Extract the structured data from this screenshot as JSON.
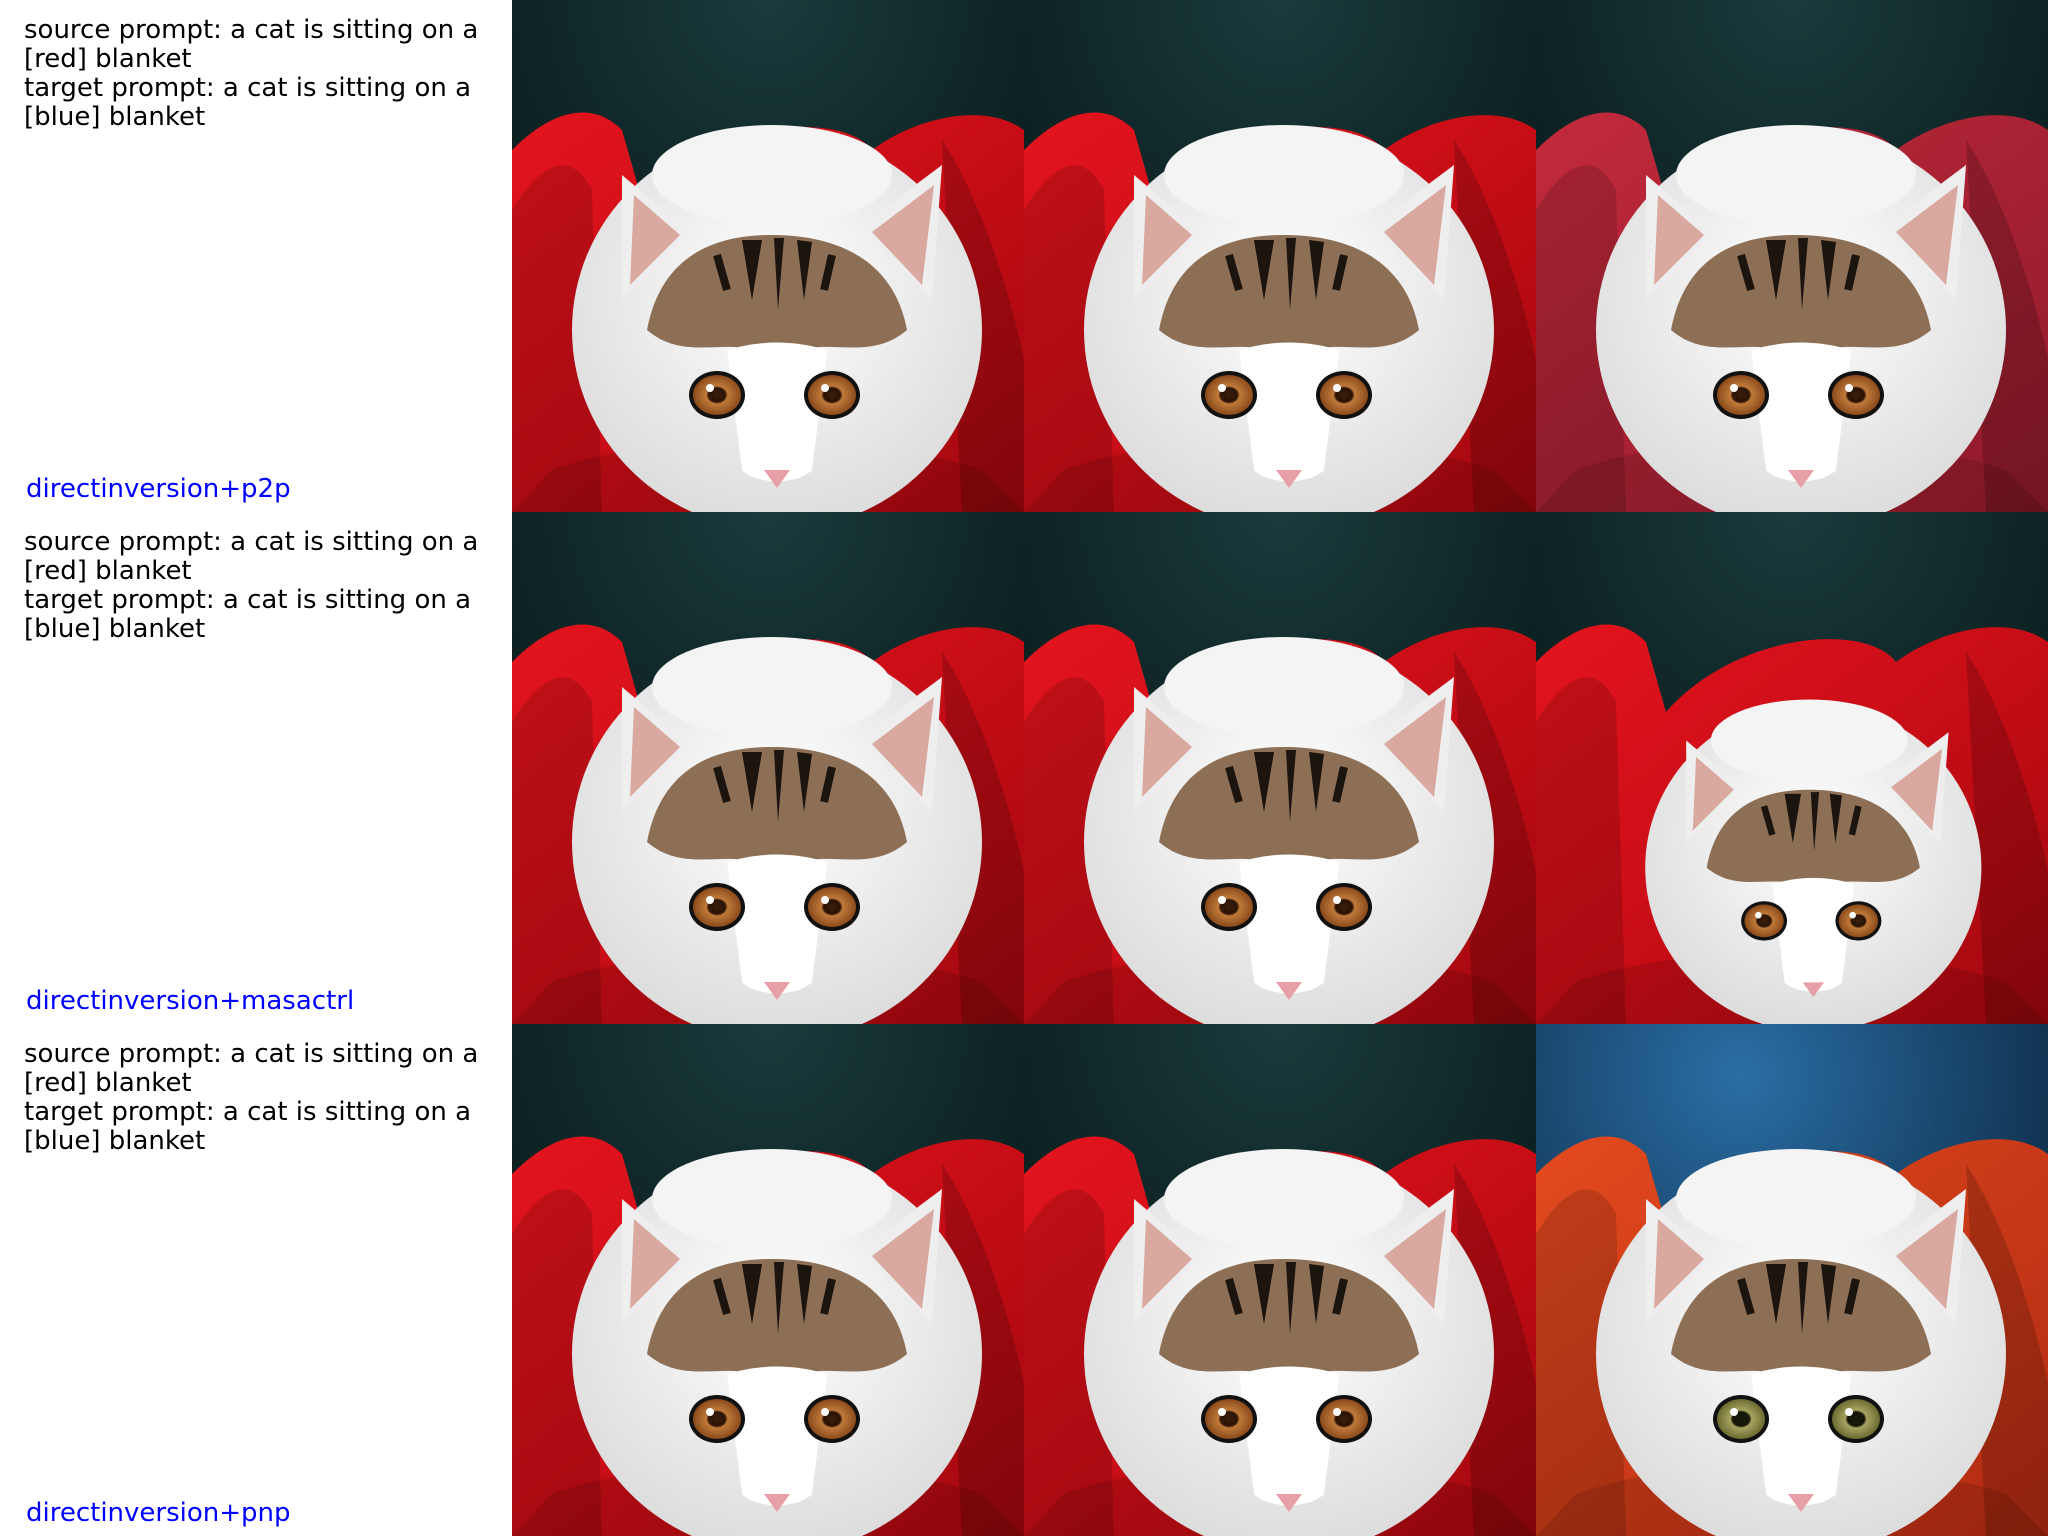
{
  "rows": [
    {
      "source_prompt": "source prompt: a cat is sitting on a [red] blanket",
      "target_prompt": "target prompt: a cat is sitting on a [blue] blanket",
      "method": "directinversion+p2p",
      "images": [
        "source-cat-red-blanket",
        "reconstruction-cat-red-blanket",
        "edited-cat-muted-red-blanket"
      ]
    },
    {
      "source_prompt": "source prompt: a cat is sitting on a [red] blanket",
      "target_prompt": "target prompt: a cat is sitting on a [blue] blanket",
      "method": "directinversion+masactrl",
      "images": [
        "source-cat-red-blanket",
        "reconstruction-cat-red-blanket",
        "edited-cat-smaller-red-blanket"
      ]
    },
    {
      "source_prompt": "source prompt: a cat is sitting on a [red] blanket",
      "target_prompt": "target prompt: a cat is sitting on a [blue] blanket",
      "method": "directinversion+pnp",
      "images": [
        "source-cat-red-blanket",
        "reconstruction-cat-red-blanket",
        "edited-cat-orange-blanket-blue-bg"
      ]
    }
  ],
  "colors": {
    "method_label": "#0000ff",
    "blanket_red": "#d0101a",
    "blanket_muted": "#b82236",
    "blanket_orange": "#d8401a",
    "bg_teal": "#0d2a2c",
    "bg_blue": "#1b5a8a"
  }
}
